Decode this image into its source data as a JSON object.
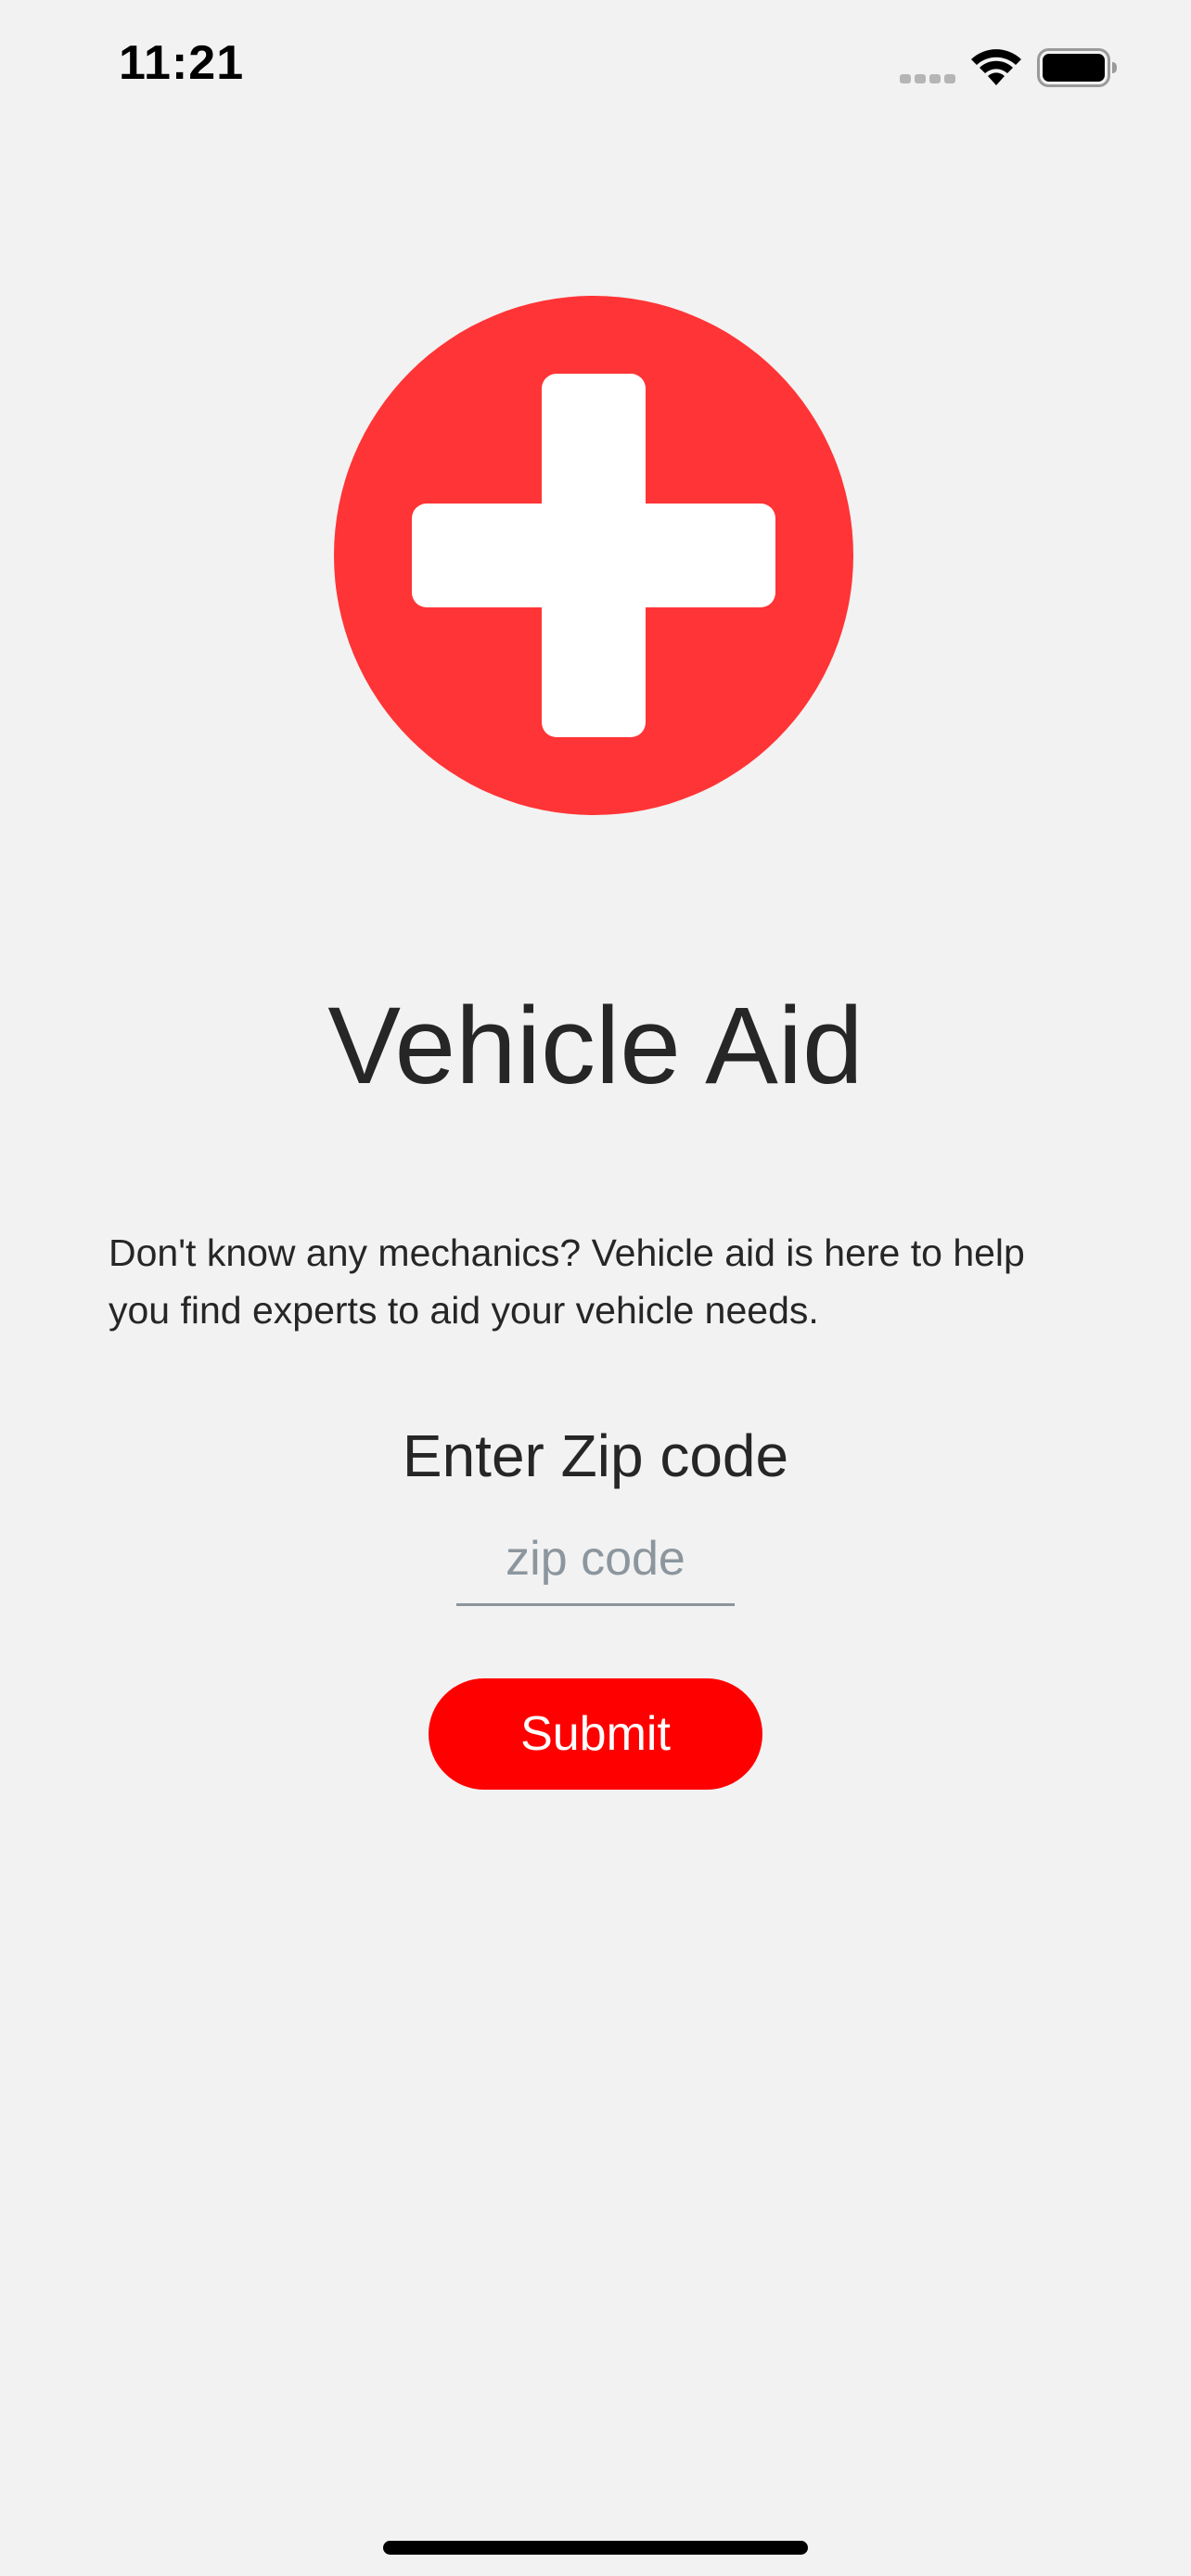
{
  "status_bar": {
    "time": "11:21",
    "icons": [
      "cellular-signal-icon",
      "wifi-icon",
      "battery-icon"
    ]
  },
  "logo": {
    "icon": "medical-cross-icon",
    "circle_color": "#ff3436",
    "cross_color": "#ffffff"
  },
  "main": {
    "title": "Vehicle Aid",
    "description": "Don't know any mechanics? Vehicle aid is here to help you find experts to aid your vehicle needs.",
    "zip_label": "Enter Zip code",
    "zip_input": {
      "placeholder": "zip code",
      "value": ""
    },
    "submit_label": "Submit"
  },
  "colors": {
    "background": "#f2f2f2",
    "button": "#ff0000",
    "text": "#262626",
    "placeholder": "#8c969e"
  }
}
